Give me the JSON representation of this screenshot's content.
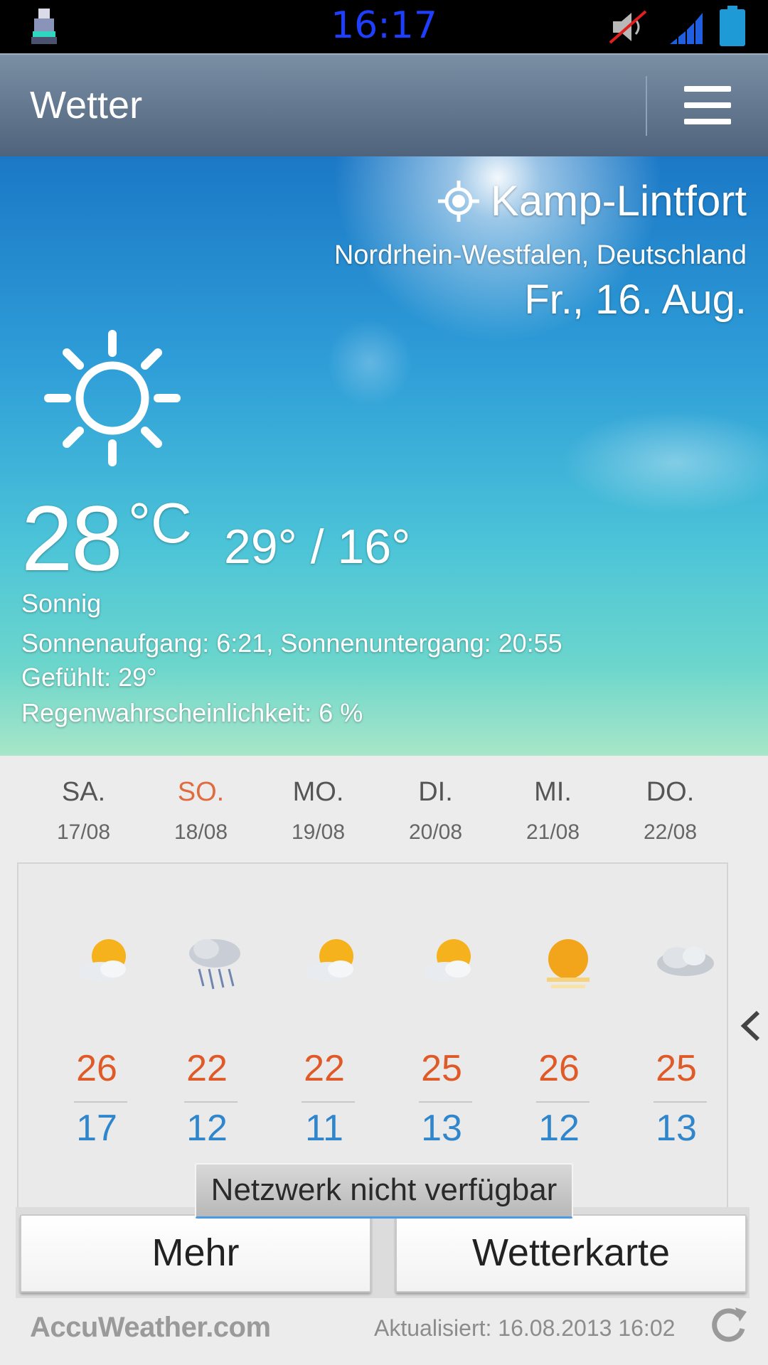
{
  "status_bar": {
    "time": "16:17",
    "icons": [
      "usb-icon",
      "volume-muted-icon",
      "signal-icon",
      "battery-icon"
    ],
    "clock_color": "#1f3fff"
  },
  "action_bar": {
    "title": "Wetter",
    "menu_icon": "hamburger-menu-icon"
  },
  "current": {
    "city": "Kamp-Lintfort",
    "region": "Nordrhein-Westfalen, Deutschland",
    "date": "Fr., 16. Aug.",
    "temperature": "28",
    "unit": "°C",
    "high_low": "29° / 16°",
    "condition": "Sonnig",
    "sun_times": "Sonnenaufgang: 6:21, Sonnenuntergang: 20:55",
    "feels_like": "Gefühlt: 29°",
    "rain_chance": "Regenwahrscheinlichkeit: 6 %",
    "icon": "sun-icon"
  },
  "forecast": [
    {
      "day": "SA.",
      "date": "17/08",
      "icon": "partly-sunny-icon",
      "high": "26",
      "low": "17"
    },
    {
      "day": "SO.",
      "date": "18/08",
      "icon": "rain-cloud-icon",
      "high": "22",
      "low": "12"
    },
    {
      "day": "MO.",
      "date": "19/08",
      "icon": "partly-sunny-icon",
      "high": "22",
      "low": "11"
    },
    {
      "day": "DI.",
      "date": "20/08",
      "icon": "partly-sunny-icon",
      "high": "25",
      "low": "13"
    },
    {
      "day": "MI.",
      "date": "21/08",
      "icon": "sun-haze-icon",
      "high": "26",
      "low": "12"
    },
    {
      "day": "DO.",
      "date": "22/08",
      "icon": "cloudy-icon",
      "high": "25",
      "low": "13"
    }
  ],
  "toast": "Netzwerk nicht verfügbar",
  "buttons": {
    "more": "Mehr",
    "map": "Wetterkarte"
  },
  "footer": {
    "brand": "AccuWeather.com",
    "updated": "Aktualisiert: 16.08.2013 16:02"
  },
  "colors": {
    "high_temp": "#e05a28",
    "low_temp": "#2f86cc",
    "sunday": "#e06b3f"
  }
}
